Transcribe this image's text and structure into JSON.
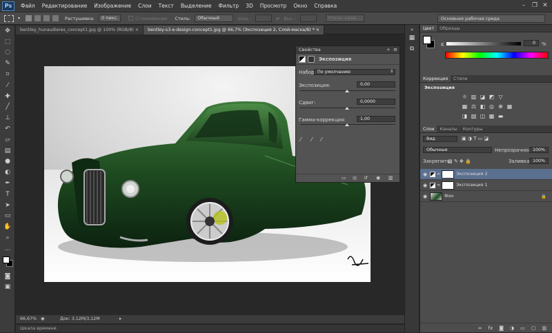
{
  "app": {
    "logo": "Ps"
  },
  "menu": [
    "Файл",
    "Редактирование",
    "Изображение",
    "Слои",
    "Текст",
    "Выделение",
    "Фильтр",
    "3D",
    "Просмотр",
    "Окно",
    "Справка"
  ],
  "window_controls": [
    "–",
    "❐",
    "✕"
  ],
  "options": {
    "feather_label": "Растушевка:",
    "feather_value": "0 пикс.",
    "antialias": "Сглаживание",
    "style_label": "Стиль:",
    "style_value": "Обычный",
    "width_label": "Шир.:",
    "height_label": "Выс.:",
    "refine": "Уточн. край...",
    "workspace": "Основная рабочая среда"
  },
  "tabs": [
    {
      "label": "bentley_hunaudieres_concept1.jpg @ 100% (RGB/8) ×"
    },
    {
      "label": "bentley-s3-e-design-concept1.jpg @ 66,7% (Экспозиция 2, Слой-маска/8) * ×"
    }
  ],
  "status": {
    "zoom": "66,67%",
    "doc": "Док: 3,12M/3,12M"
  },
  "timeline": "Шкала времени",
  "properties": {
    "title": "Свойства",
    "adjustment": "Экспозиция",
    "preset_label": "Набор:",
    "preset_value": "По умолчанию",
    "exposure_label": "Экспозиция:",
    "exposure_value": "0,00",
    "offset_label": "Сдвиг:",
    "offset_value": "0,0000",
    "gamma_label": "Гамма-коррекция:",
    "gamma_value": "1,00"
  },
  "color_panel": {
    "tabs": [
      "Цвет",
      "Образцы"
    ],
    "channel": "K",
    "value": "0",
    "unit": "%"
  },
  "corrections": {
    "tabs": [
      "Коррекция",
      "Стили"
    ],
    "subtitle": "Экспозиция"
  },
  "layers_panel": {
    "tabs": [
      "Слои",
      "Каналы",
      "Контуры"
    ],
    "filter": "Вид",
    "blend": "Обычные",
    "opacity_label": "Непрозрачность:",
    "opacity": "100%",
    "lock_label": "Закрепить:",
    "fill_label": "Заливка:",
    "fill": "100%",
    "layers": [
      {
        "name": "Экспозиция 2",
        "selected": true
      },
      {
        "name": "Экспозиция 1",
        "selected": false
      },
      {
        "name": "Фон",
        "selected": false
      }
    ]
  },
  "colors": {
    "accent": "#5b6f8f",
    "car": "#1f4a22"
  }
}
